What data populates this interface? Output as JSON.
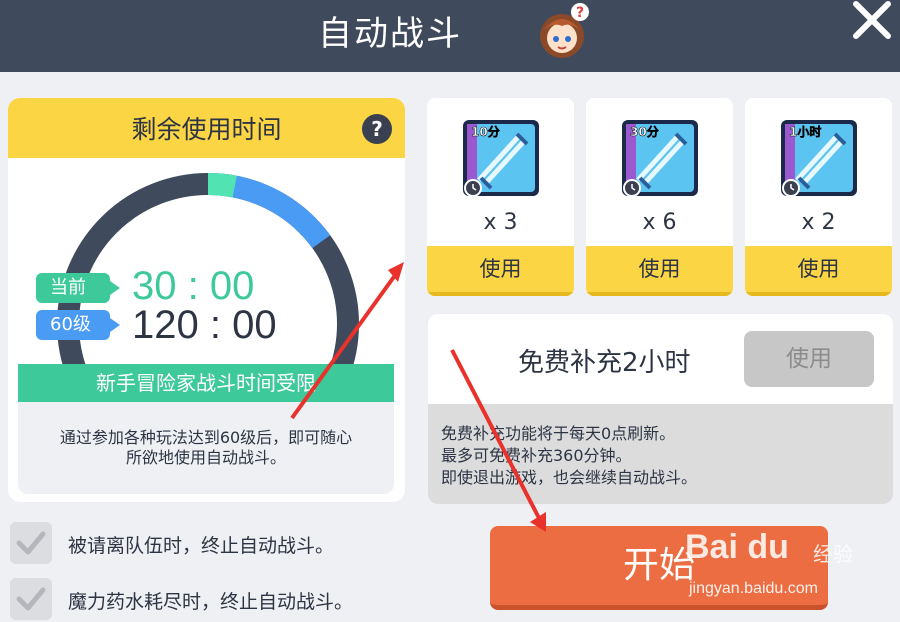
{
  "header": {
    "title": "自动战斗",
    "close_icon": "close-icon",
    "avatar_icon": "character-avatar-icon"
  },
  "remaining": {
    "title": "剩余使用时间",
    "help_label": "?",
    "current_label": "当前",
    "current_time": "30 : 00",
    "level_label": "60级",
    "limit_time": "120 : 00",
    "progress_fraction": 0.25,
    "limit_banner": "新手冒险家战斗时间受限",
    "limit_desc_line1": "通过参加各种玩法达到60级后，即可随心",
    "limit_desc_line2": "所欲地使用自动战斗。"
  },
  "items": [
    {
      "icon_label": "10分",
      "count": "x 3",
      "button": "使用"
    },
    {
      "icon_label": "30分",
      "count": "x 6",
      "button": "使用"
    },
    {
      "icon_label": "1小时",
      "count": "x 2",
      "button": "使用"
    }
  ],
  "free_refill": {
    "title": "免费补充2小时",
    "button": "使用",
    "desc_line1": "免费补充功能将于每天0点刷新。",
    "desc_line2": "最多可免费补充360分钟。",
    "desc_line3": "即使退出游戏，也会继续自动战斗。"
  },
  "options": [
    {
      "label": "被请离队伍时，终止自动战斗。",
      "checked": true
    },
    {
      "label": "魔力药水耗尽时，终止自动战斗。",
      "checked": true
    }
  ],
  "start_button": "开始",
  "watermark": {
    "brand": "Bai du",
    "sub": "经验",
    "url": "jingyan.baidu.com"
  },
  "colors": {
    "header": "#3f4a5c",
    "yellow": "#fbd543",
    "green": "#3ec99a",
    "blue": "#4a9bf4",
    "start": "#ec6d41",
    "arrow": "#e8322b"
  }
}
